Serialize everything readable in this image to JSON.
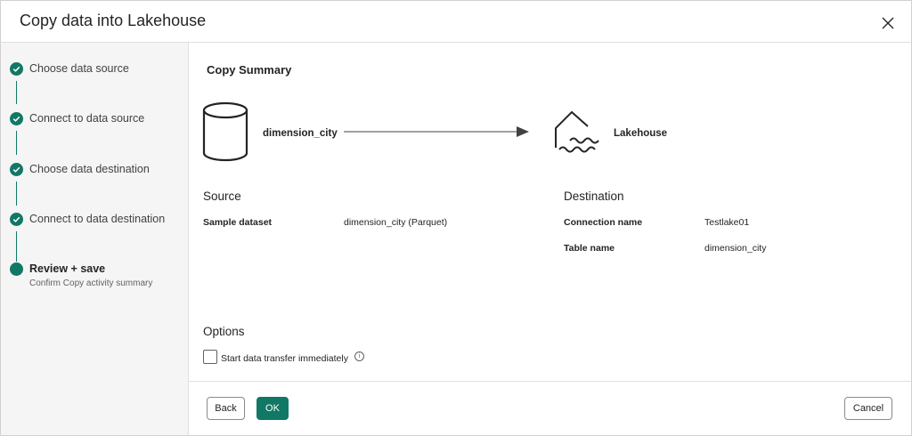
{
  "dialog": {
    "title": "Copy data into Lakehouse",
    "close_icon": "close-icon"
  },
  "steps": [
    {
      "label": "Choose data source",
      "status": "completed"
    },
    {
      "label": "Connect to data source",
      "status": "completed"
    },
    {
      "label": "Choose data destination",
      "status": "completed"
    },
    {
      "label": "Connect to data destination",
      "status": "completed"
    },
    {
      "label": "Review + save",
      "sublabel": "Confirm Copy activity summary",
      "status": "current"
    }
  ],
  "summary": {
    "title": "Copy Summary",
    "source_name": "dimension_city",
    "destination_name": "Lakehouse",
    "source_icon": "database-icon",
    "destination_icon": "lakehouse-icon",
    "arrow_icon": "arrow-right-icon"
  },
  "source": {
    "heading": "Source",
    "rows": [
      {
        "key": "Sample dataset",
        "value": "dimension_city (Parquet)"
      }
    ]
  },
  "destination": {
    "heading": "Destination",
    "rows": [
      {
        "key": "Connection name",
        "value": "Testlake01"
      },
      {
        "key": "Table name",
        "value": "dimension_city"
      }
    ]
  },
  "options": {
    "heading": "Options",
    "start_transfer_label": "Start data transfer immediately",
    "start_transfer_checked": false,
    "info_icon": "info-icon"
  },
  "footer": {
    "back_label": "Back",
    "ok_label": "OK",
    "cancel_label": "Cancel"
  },
  "colors": {
    "accent": "#117865",
    "border": "#d1d1d1",
    "sidebar_bg": "#f5f5f5"
  }
}
